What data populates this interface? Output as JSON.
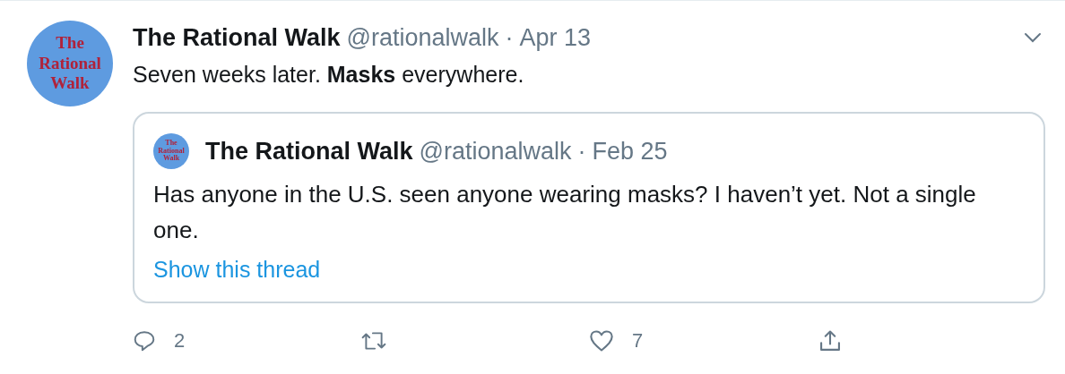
{
  "tweet": {
    "avatar_text": "The Rational Walk",
    "name": "The Rational Walk",
    "handle": "@rationalwalk",
    "separator": "·",
    "date": "Apr 13",
    "text": "Seven weeks later. **Masks** everywhere.",
    "quote": {
      "avatar_text": "The Rational Walk",
      "name": "The Rational Walk",
      "handle": "@rationalwalk",
      "separator": "·",
      "date": "Feb 25",
      "text": "Has anyone in the U.S. seen anyone wearing masks? I haven’t yet. Not a single one.",
      "link": "Show this thread"
    },
    "actions": [
      {
        "kind": "reply",
        "count": "2"
      },
      {
        "kind": "retweet"
      },
      {
        "kind": "like",
        "count": "7"
      },
      {
        "kind": "share"
      }
    ]
  }
}
